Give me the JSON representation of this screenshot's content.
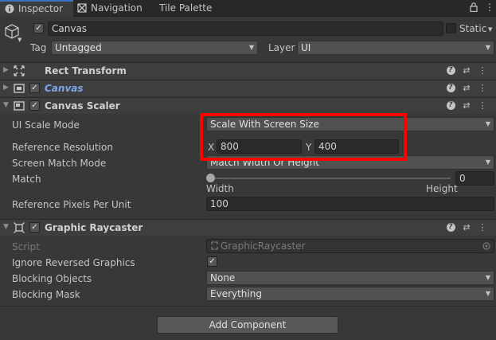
{
  "tabs": [
    {
      "label": "Inspector",
      "icon": "info-icon",
      "active": true
    },
    {
      "label": "Navigation",
      "icon": "navigation-icon",
      "active": false
    },
    {
      "label": "Tile Palette",
      "icon": "",
      "active": false
    }
  ],
  "object": {
    "name": "Canvas",
    "static_label": "Static",
    "tag_label": "Tag",
    "tag_value": "Untagged",
    "layer_label": "Layer",
    "layer_value": "UI"
  },
  "components": {
    "rect_transform": {
      "title": "Rect Transform"
    },
    "canvas": {
      "title": "Canvas"
    },
    "canvas_scaler": {
      "title": "Canvas Scaler",
      "ui_scale_mode_label": "UI Scale Mode",
      "ui_scale_mode_value": "Scale With Screen Size",
      "reference_resolution_label": "Reference Resolution",
      "x_label": "X",
      "x_value": "800",
      "y_label": "Y",
      "y_value": "400",
      "screen_match_mode_label": "Screen Match Mode",
      "screen_match_mode_value": "Match Width Or Height",
      "match_label": "Match",
      "match_value": "0",
      "width_label": "Width",
      "height_label": "Height",
      "ref_pixels_label": "Reference Pixels Per Unit",
      "ref_pixels_value": "100"
    },
    "graphic_raycaster": {
      "title": "Graphic Raycaster",
      "script_label": "Script",
      "script_value": "GraphicRaycaster",
      "ignore_reversed_label": "Ignore Reversed Graphics",
      "blocking_objects_label": "Blocking Objects",
      "blocking_objects_value": "None",
      "blocking_mask_label": "Blocking Mask",
      "blocking_mask_value": "Everything"
    }
  },
  "add_component_label": "Add Component",
  "colors": {
    "background": "#383838",
    "highlight": "#ff0000",
    "active_tab_accent": "#3a72c4",
    "canvas_title": "#7ba6e8"
  }
}
